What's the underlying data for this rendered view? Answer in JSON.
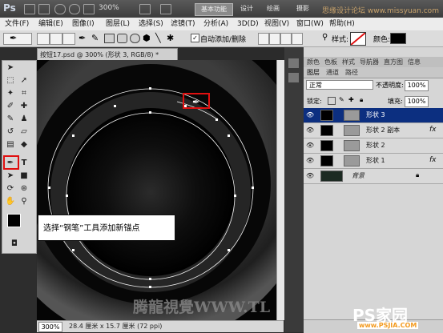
{
  "titlebar": {
    "logo": "Ps",
    "zoom": "300%",
    "workspaces": [
      "基本功能",
      "设计",
      "绘画",
      "摄影"
    ],
    "watermark": "思缘设计论坛 www.missyuan.com"
  },
  "menu": [
    "文件(F)",
    "编辑(E)",
    "图像(I)",
    "图层(L)",
    "选择(S)",
    "滤镜(T)",
    "分析(A)",
    "3D(D)",
    "视图(V)",
    "窗口(W)",
    "帮助(H)"
  ],
  "options": {
    "auto_add_delete": "自动添加/删除",
    "style_label": "样式:",
    "color_label": "颜色:",
    "color_value": "#000000"
  },
  "document": {
    "tab_title": "按钮17.psd @ 300% (形状 3, RGB/8) *",
    "zoom": "300%",
    "info": "28.4 厘米 x 15.7 厘米 (72 ppi)"
  },
  "callout": "选择“钢笔”工具添加新锚点",
  "canvas_watermark": "腾龍視覺WWW.TL",
  "panels": {
    "top_tabs": [
      "颜色",
      "色板",
      "样式",
      "导航器",
      "直方图",
      "信息"
    ],
    "layer_tabs": [
      "图层",
      "通道",
      "路径"
    ],
    "blend_mode": "正常",
    "opacity_label": "不透明度:",
    "opacity_value": "100%",
    "lock_label": "锁定:",
    "fill_label": "填充:",
    "fill_value": "100%",
    "layers": [
      {
        "name": "形状 3",
        "selected": true,
        "fx": ""
      },
      {
        "name": "形状 2 副本",
        "selected": false,
        "fx": "fx"
      },
      {
        "name": "形状 2",
        "selected": false,
        "fx": ""
      },
      {
        "name": "形状 1",
        "selected": false,
        "fx": "fx"
      },
      {
        "name": "背景",
        "selected": false,
        "fx": ""
      }
    ]
  },
  "bottom_logo": {
    "text": "PS家园",
    "url": "www.PSJIA.COM"
  },
  "accent": "#e01010"
}
